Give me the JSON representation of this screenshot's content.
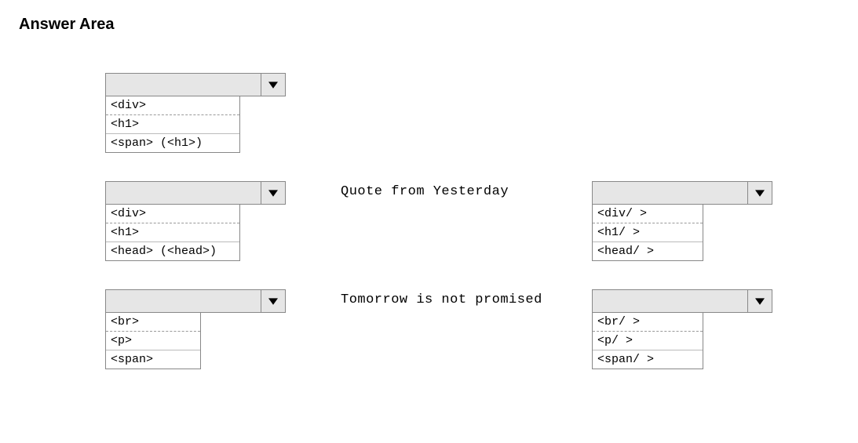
{
  "title": "Answer Area",
  "row1": {
    "left": {
      "items": [
        "<div>",
        "<h1>",
        "<span> (<h1>)"
      ]
    }
  },
  "row2": {
    "left": {
      "items": [
        "<div>",
        "<h1>",
        "<head> (<head>)"
      ]
    },
    "center": "Quote from Yesterday",
    "right": {
      "items": [
        "<div/ >",
        "<h1/ >",
        "<head/ >"
      ]
    }
  },
  "row3": {
    "left": {
      "items": [
        "<br>",
        "<p>",
        "<span>"
      ]
    },
    "center": "Tomorrow is not promised",
    "right": {
      "items": [
        "<br/ >",
        "<p/ >",
        "<span/ >"
      ]
    }
  }
}
